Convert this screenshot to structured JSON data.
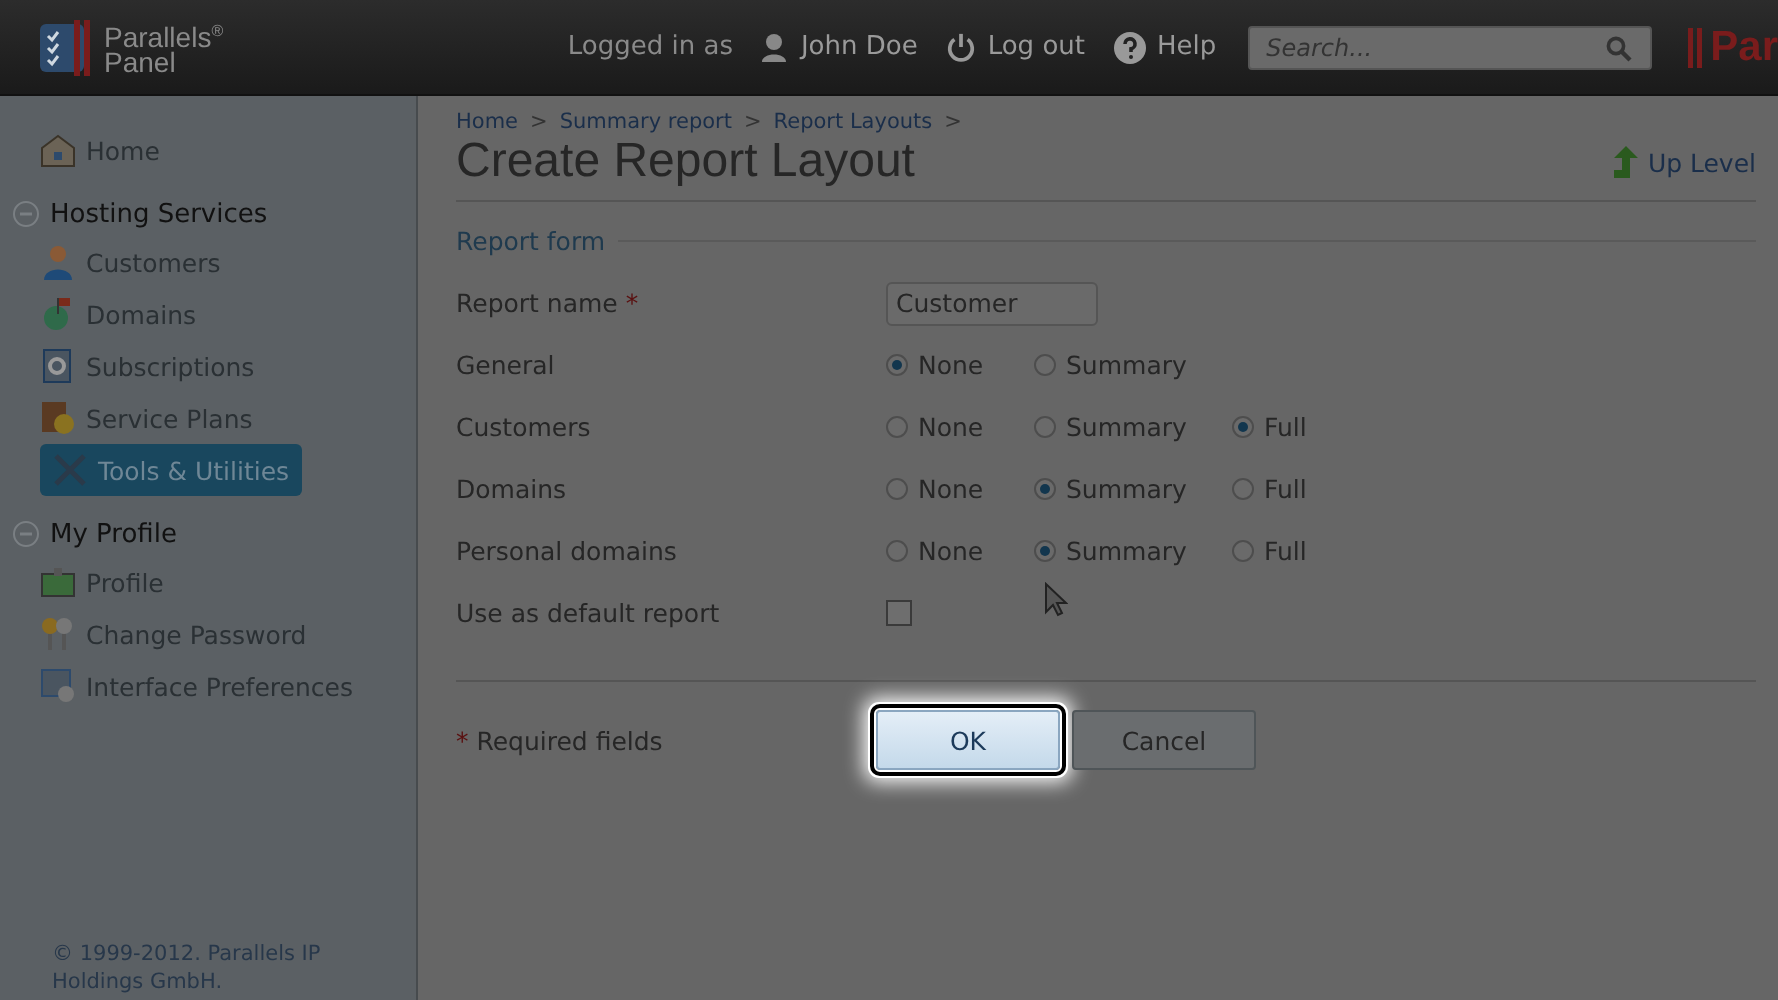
{
  "header": {
    "logo_line1": "Parallels",
    "logo_mark": "®",
    "logo_line2": "Panel",
    "logged_in_label": "Logged in as",
    "user": "John Doe",
    "logout": "Log out",
    "help": "Help",
    "search": {
      "placeholder": "Search..."
    },
    "brand_cut": "Par"
  },
  "sidebar": {
    "items": [
      {
        "kind": "link",
        "label": "Home",
        "selected": false
      },
      {
        "kind": "section",
        "label": "Hosting Services",
        "expanded": true,
        "children": [
          {
            "label": "Customers",
            "selected": false
          },
          {
            "label": "Domains",
            "selected": false
          },
          {
            "label": "Subscriptions",
            "selected": false
          },
          {
            "label": "Service Plans",
            "selected": false
          },
          {
            "label": "Tools & Utilities",
            "selected": true
          }
        ]
      },
      {
        "kind": "section",
        "label": "My Profile",
        "expanded": true,
        "children": [
          {
            "label": "Profile",
            "selected": false
          },
          {
            "label": "Change Password",
            "selected": false
          },
          {
            "label": "Interface Preferences",
            "selected": false
          }
        ]
      }
    ],
    "copyright": "© 1999-2012. Parallels IP Holdings GmbH."
  },
  "breadcrumbs": [
    {
      "label": "Home",
      "separator": ">"
    },
    {
      "label": "Summary report",
      "separator": ">"
    },
    {
      "label": "Report Layouts",
      "separator": ">"
    }
  ],
  "page_title": "Create Report Layout",
  "up_level": "Up Level",
  "form": {
    "legend": "Report form",
    "rows": [
      {
        "kind": "text",
        "label": "Report name",
        "required_mark": "*",
        "value": "Customer"
      },
      {
        "kind": "radio",
        "label": "General",
        "options": [
          {
            "label": "None",
            "selected": true
          },
          {
            "label": "Summary",
            "selected": false
          }
        ]
      },
      {
        "kind": "radio",
        "label": "Customers",
        "options": [
          {
            "label": "None",
            "selected": false
          },
          {
            "label": "Summary",
            "selected": false
          },
          {
            "label": "Full",
            "selected": true
          }
        ]
      },
      {
        "kind": "radio",
        "label": "Domains",
        "options": [
          {
            "label": "None",
            "selected": false
          },
          {
            "label": "Summary",
            "selected": true
          },
          {
            "label": "Full",
            "selected": false
          }
        ]
      },
      {
        "kind": "radio",
        "label": "Personal domains",
        "options": [
          {
            "label": "None",
            "selected": false
          },
          {
            "label": "Summary",
            "selected": true
          },
          {
            "label": "Full",
            "selected": false
          }
        ]
      },
      {
        "kind": "checkbox",
        "label": "Use as default report",
        "checked": false
      }
    ],
    "required_note_mark": "*",
    "required_note": "Required fields",
    "buttons": [
      {
        "label": "OK",
        "highlighted": true
      },
      {
        "label": "Cancel",
        "highlighted": false
      }
    ]
  }
}
